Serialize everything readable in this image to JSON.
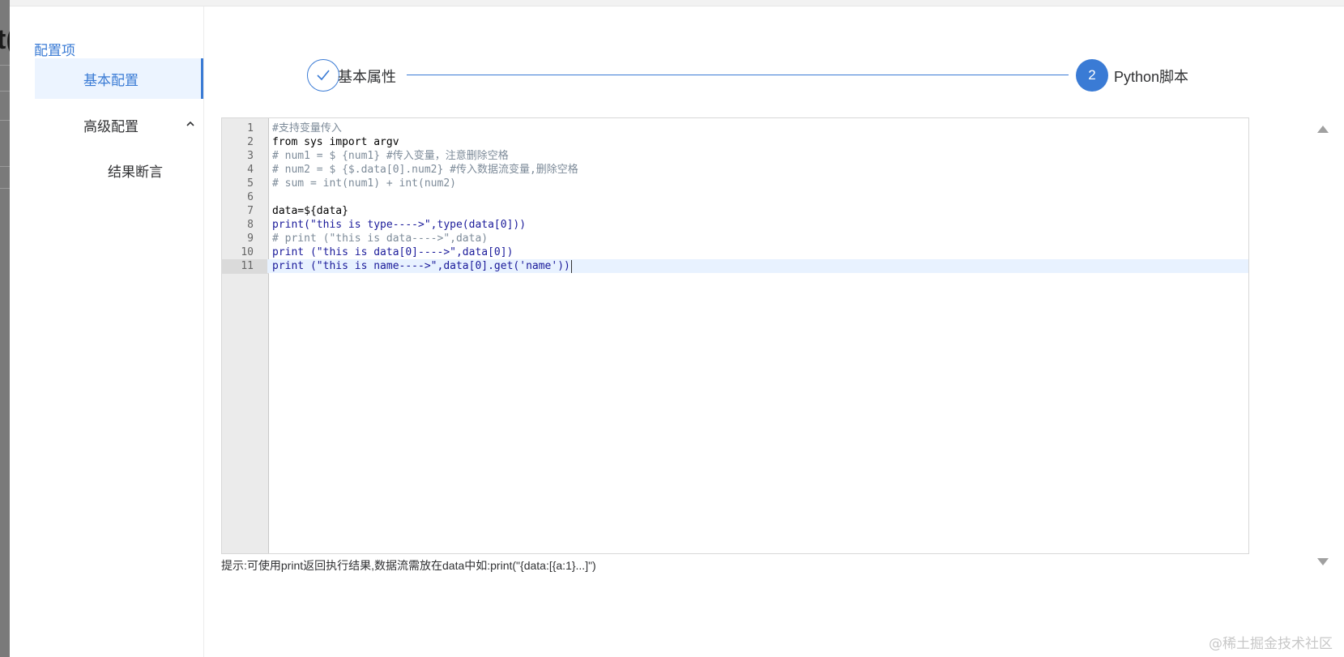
{
  "backdrop": {
    "title_fragment": "t("
  },
  "sidebar": {
    "title": "配置项",
    "items": [
      {
        "label": "基本配置",
        "active": true
      },
      {
        "label": "高级配置",
        "expanded": true
      },
      {
        "label": "结果断言"
      }
    ]
  },
  "steps": [
    {
      "label": "基本属性",
      "status": "done",
      "icon": "check-icon"
    },
    {
      "number": "2",
      "label": "Python脚本",
      "status": "active"
    }
  ],
  "editor": {
    "line_numbers": [
      "1",
      "2",
      "3",
      "4",
      "5",
      "6",
      "7",
      "8",
      "9",
      "10",
      "11"
    ],
    "active_line": 11,
    "lines": [
      "#支持变量传入",
      "from sys import argv",
      "# num1 = $ {num1} #传入变量，注意删除空格",
      "# num2 = $ {$.data[0].num2} #传入数据流变量,删除空格",
      "# sum = int(num1) + int(num2)",
      "",
      "data=${data}",
      "print(\"this is type---->\",type(data[0]))",
      "# print (\"this is data---->\",data)",
      "print (\"this is data[0]---->\",data[0])",
      "print (\"this is name---->\",data[0].get('name'))"
    ]
  },
  "hint": "提示:可使用print返回执行结果,数据流需放在data中如:print(\"{data:[{a:1}...]\")",
  "watermark": "@稀土掘金技术社区",
  "colors": {
    "accent": "#3a7bd5",
    "active_menu_bg": "#ecf4ff",
    "gutter_bg": "#ebebeb"
  }
}
